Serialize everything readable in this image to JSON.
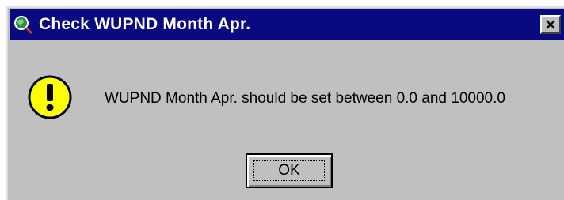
{
  "window": {
    "title": "Check WUPND Month Apr.",
    "title_icon": "globe-magnifier-icon",
    "close_icon": "close-icon",
    "titlebar_color": "#0a0a80",
    "background_color": "#c0c0c0"
  },
  "content": {
    "icon": "exclamation-warning-icon",
    "icon_color": "#ffff00",
    "message": "WUPND Month Apr. should be set between 0.0 and 10000.0"
  },
  "buttons": {
    "ok_label": "OK"
  }
}
